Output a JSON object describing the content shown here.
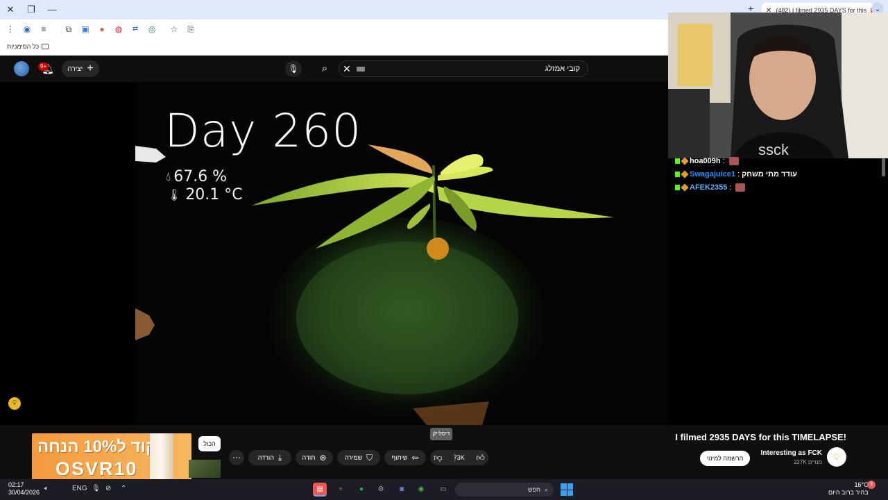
{
  "browser": {
    "tab_title": "(482) I filmed 2935 DAYS for this",
    "bookmarks_all_label": "כל הסימניות"
  },
  "youtube": {
    "notification_count": "9+",
    "create_label": "יצירה",
    "search_query": "קובי אמזלג",
    "video_overlay": {
      "day": "Day 260",
      "humidity": "67.6 %",
      "temperature": "20.1 °C"
    }
  },
  "chat": {
    "messages": [
      {
        "user": "hoa009h",
        "text": ""
      },
      {
        "user": "Swagajuice1",
        "text": "עודד מתי משחק"
      },
      {
        "user": "AFEK2355",
        "text": ""
      }
    ]
  },
  "below_video": {
    "ad_line1": "קוד ל10% הנחה",
    "ad_line2": "OSVR10",
    "all_chip": "הכול",
    "download_label": "הורדה",
    "thanks_label": "תודה",
    "save_label": "שמירה",
    "share_label": "שיתוף",
    "likes_count": "73K",
    "dislike_tooltip": "דיסלייק",
    "video_title": "I filmed 2935 DAYS for this TIMELAPSE!",
    "channel_name": "Interesting as FCK",
    "channel_subs": "227K מנויים",
    "subscribe_label": "הרשמה למינוי"
  },
  "taskbar": {
    "time": "02:17",
    "date": "30/04/2026",
    "language": "ENG",
    "search_label": "חפש",
    "weather_temp": "16°C",
    "weather_desc": "בהיר ברוב היום",
    "notification_count": "3"
  },
  "colors": {
    "youtube_bg": "#0f0f0f",
    "accent_blue": "#1e90ff",
    "ad_orange": "#f39a3d",
    "windows_blue": "#3aa0f4"
  }
}
